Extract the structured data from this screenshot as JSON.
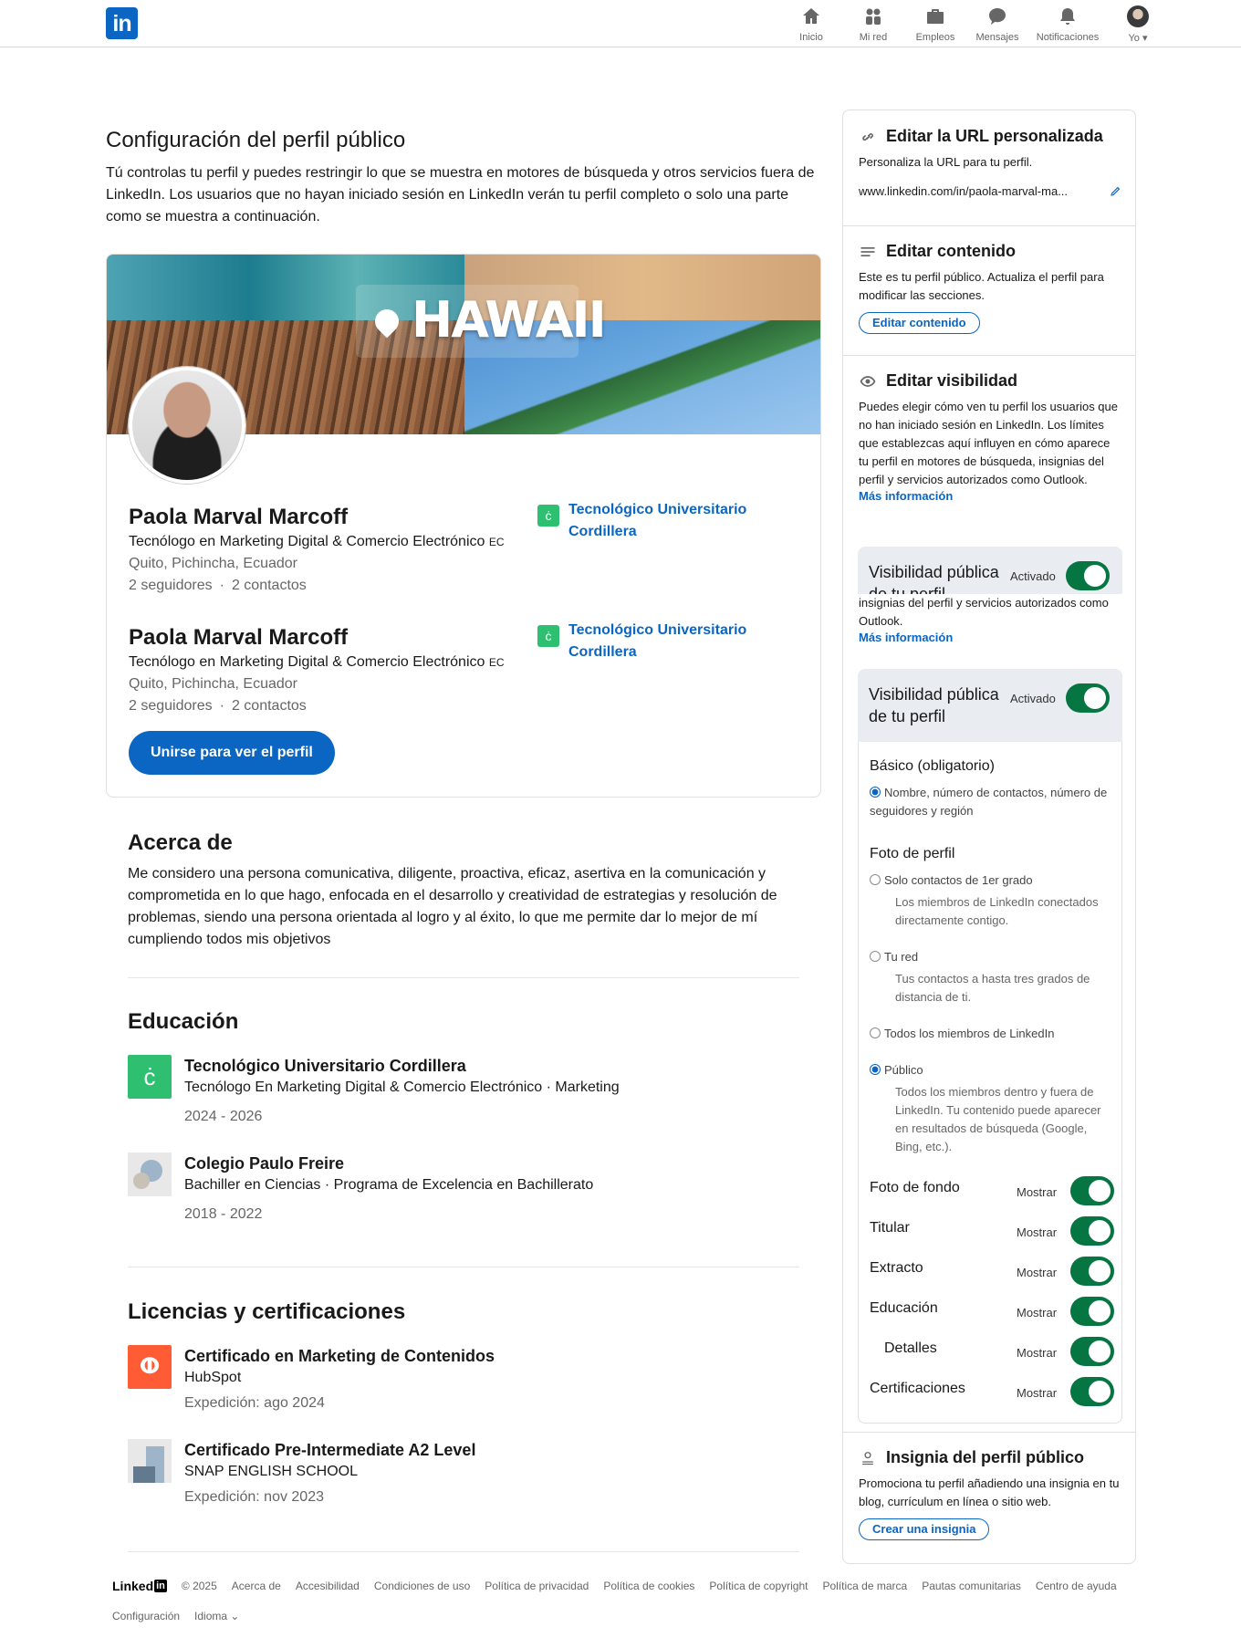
{
  "nav": {
    "items": [
      {
        "label": "Inicio",
        "icon": "home-icon"
      },
      {
        "label": "Mi red",
        "icon": "network-icon"
      },
      {
        "label": "Empleos",
        "icon": "briefcase-icon"
      },
      {
        "label": "Mensajes",
        "icon": "messaging-icon"
      },
      {
        "label": "Notificaciones",
        "icon": "bell-icon"
      },
      {
        "label": "Yo",
        "icon": "avatar"
      }
    ]
  },
  "page": {
    "title": "Configuración del perfil público",
    "description": "Tú controlas tu perfil y puedes restringir lo que se muestra en motores de búsqueda y otros servicios fuera de LinkedIn. Los usuarios que no hayan iniciado sesión en LinkedIn verán tu perfil completo o solo una parte como se muestra a continuación."
  },
  "profile": {
    "banner_text": "HAWAII",
    "name": "Paola Marval Marcoff",
    "headline": "Tecnólogo en Marketing Digital & Comercio Electrónico",
    "headline_suffix": "EC",
    "location": "Quito, Pichincha, Ecuador",
    "followers": "2 seguidores",
    "dot": "·",
    "contacts": "2 contactos",
    "school": "Tecnológico Universitario Cordillera",
    "join_button": "Unirse para ver el perfil"
  },
  "about": {
    "title": "Acerca de",
    "text": "Me considero una persona comunicativa, diligente, proactiva, eficaz, asertiva en la comunicación y comprometida en lo que hago, enfocada en el desarrollo y creatividad de estrategias y resolución de problemas, siendo una persona orientada al logro y al éxito, lo que me permite dar lo mejor de mí cumpliendo todos mis objetivos"
  },
  "education": {
    "title": "Educación",
    "items": [
      {
        "school": "Tecnológico Universitario Cordillera",
        "degree": "Tecnólogo En Marketing Digital & Comercio Electrónico  · Marketing",
        "dates": "2024 - 2026"
      },
      {
        "school": "Colegio Paulo Freire",
        "degree": "Bachiller en Ciencias  · Programa de Excelencia en Bachillerato",
        "dates": "2018 - 2022"
      }
    ]
  },
  "licenses": {
    "title": "Licencias y certificaciones",
    "items": [
      {
        "name": "Certificado en Marketing de Contenidos",
        "issuer": "HubSpot",
        "issued": "Expedición: ago 2024"
      },
      {
        "name": "Certificado Pre-Intermediate A2 Level",
        "issuer": "SNAP ENGLISH SCHOOL",
        "issued": "Expedición: nov 2023"
      }
    ]
  },
  "sidebar": {
    "url": {
      "title": "Editar la URL personalizada",
      "text": "Personaliza la URL para tu perfil.",
      "value": "www.linkedin.com/in/paola-marval-ma..."
    },
    "content": {
      "title": "Editar contenido",
      "text": "Este es tu perfil público. Actualiza el perfil para modificar las secciones.",
      "button": "Editar contenido"
    },
    "visibility": {
      "title": "Editar visibilidad",
      "text": "Puedes elegir cómo ven tu perfil los usuarios que no han iniciado sesión en LinkedIn. Los límites que establezcas aquí influyen en cómo aparece tu perfil en motores de búsqueda, insignias del perfil y servicios autorizados como Outlook.",
      "text_tail": "insignias del perfil y servicios autorizados como Outlook.",
      "more": "Más información",
      "panel_title": "Visibilidad pública de tu perfil",
      "panel_state": "Activado",
      "basic_title": "Básico (obligatorio)",
      "basic_option": "Nombre, número de contactos, número de seguidores y región",
      "photo_title": "Foto de perfil",
      "photo_options": [
        {
          "label": "Solo contactos de 1er grado",
          "desc": "Los miembros de LinkedIn conectados directamente contigo."
        },
        {
          "label": "Tu red",
          "desc": "Tus contactos a hasta tres grados de distancia de ti."
        },
        {
          "label": "Todos los miembros de LinkedIn",
          "desc": ""
        },
        {
          "label": "Público",
          "desc": "Todos los miembros dentro y fuera de LinkedIn. Tu contenido puede aparecer en resultados de búsqueda (Google, Bing, etc.)."
        }
      ],
      "toggles": [
        {
          "label": "Foto de fondo",
          "state": "Mostrar"
        },
        {
          "label": "Titular",
          "state": "Mostrar"
        },
        {
          "label": "Extracto",
          "state": "Mostrar"
        },
        {
          "label": "Educación",
          "state": "Mostrar"
        },
        {
          "label": "Detalles",
          "state": "Mostrar"
        },
        {
          "label": "Certificaciones",
          "state": "Mostrar"
        }
      ]
    },
    "badge": {
      "title": "Insignia del perfil público",
      "text": "Promociona tu perfil añadiendo una insignia en tu blog, currículum en línea o sitio web.",
      "button": "Crear una insignia"
    }
  },
  "footer": {
    "brand": "Linked",
    "brand_in": "in",
    "year": "© 2025",
    "links": [
      "Acerca de",
      "Accesibilidad",
      "Condiciones de uso",
      "Política de privacidad",
      "Política de cookies",
      "Política de copyright",
      "Política de marca",
      "Pautas comunitarias",
      "Centro de ayuda"
    ],
    "links2": [
      "Configuración",
      "Idioma"
    ]
  },
  "colors": {
    "accent": "#0a66c2",
    "toggle_on": "#057642",
    "school_logo": "#2fbf71",
    "hubspot": "#ff5c35"
  }
}
